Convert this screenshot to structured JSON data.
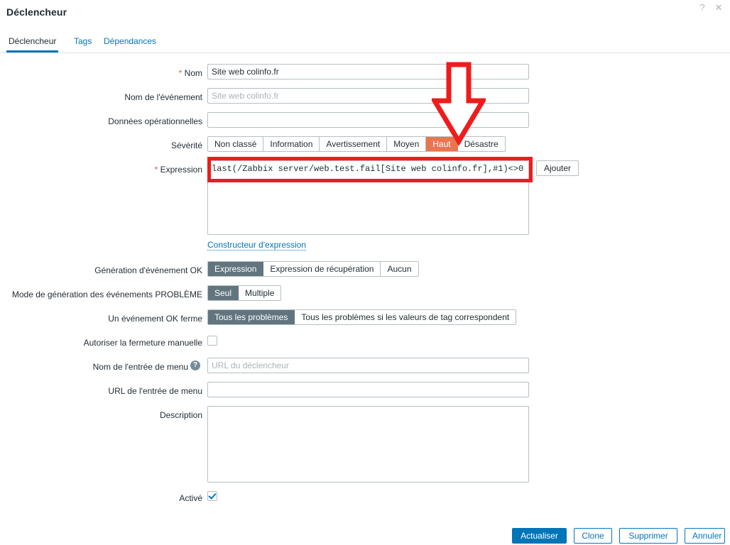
{
  "dialog": {
    "title": "Déclencheur",
    "help_icon": "?",
    "close_icon": "✕"
  },
  "tabs": [
    {
      "label": "Déclencheur",
      "active": true
    },
    {
      "label": "Tags",
      "active": false
    },
    {
      "label": "Dépendances",
      "active": false
    }
  ],
  "form": {
    "name": {
      "label": "Nom",
      "required": "*",
      "value": "Site web colinfo.fr",
      "placeholder": ""
    },
    "event_name": {
      "label": "Nom de l'événement",
      "value": "",
      "placeholder": "Site web colinfo.fr"
    },
    "operational_data": {
      "label": "Données opérationnelles",
      "value": "",
      "placeholder": ""
    },
    "severity": {
      "label": "Sévérité",
      "options": [
        "Non classé",
        "Information",
        "Avertissement",
        "Moyen",
        "Haut",
        "Désastre"
      ],
      "selected": "Haut",
      "selected_color": "#e8764f"
    },
    "expression": {
      "label": "Expression",
      "required": "*",
      "value": "last(/Zabbix server/web.test.fail[Site web colinfo.fr],#1)<>0",
      "add_button": "Ajouter",
      "constructor_link": "Constructeur d'expression"
    },
    "ok_event_generation": {
      "label": "Génération d'événement OK",
      "options": [
        "Expression",
        "Expression de récupération",
        "Aucun"
      ],
      "selected": "Expression"
    },
    "problem_event_mode": {
      "label": "Mode de génération des événements PROBLÈME",
      "options": [
        "Seul",
        "Multiple"
      ],
      "selected": "Seul"
    },
    "ok_event_closes": {
      "label": "Un événement OK ferme",
      "options": [
        "Tous les problèmes",
        "Tous les problèmes si les valeurs de tag correspondent"
      ],
      "selected": "Tous les problèmes"
    },
    "allow_manual_close": {
      "label": "Autoriser la fermeture manuelle",
      "checked": false
    },
    "menu_entry_name": {
      "label": "Nom de l'entrée de menu",
      "value": "",
      "placeholder": "URL du déclencheur",
      "has_help": true
    },
    "menu_entry_url": {
      "label": "URL de l'entrée de menu",
      "value": "",
      "placeholder": ""
    },
    "description": {
      "label": "Description",
      "value": "",
      "placeholder": ""
    },
    "enabled": {
      "label": "Activé",
      "checked": true
    }
  },
  "footer": {
    "update": "Actualiser",
    "clone": "Clone",
    "delete": "Supprimer",
    "cancel": "Annuler"
  },
  "annotations": {
    "color": "#ee1c1c",
    "arrow_target": "Haut",
    "rect_target": "expression-input"
  }
}
